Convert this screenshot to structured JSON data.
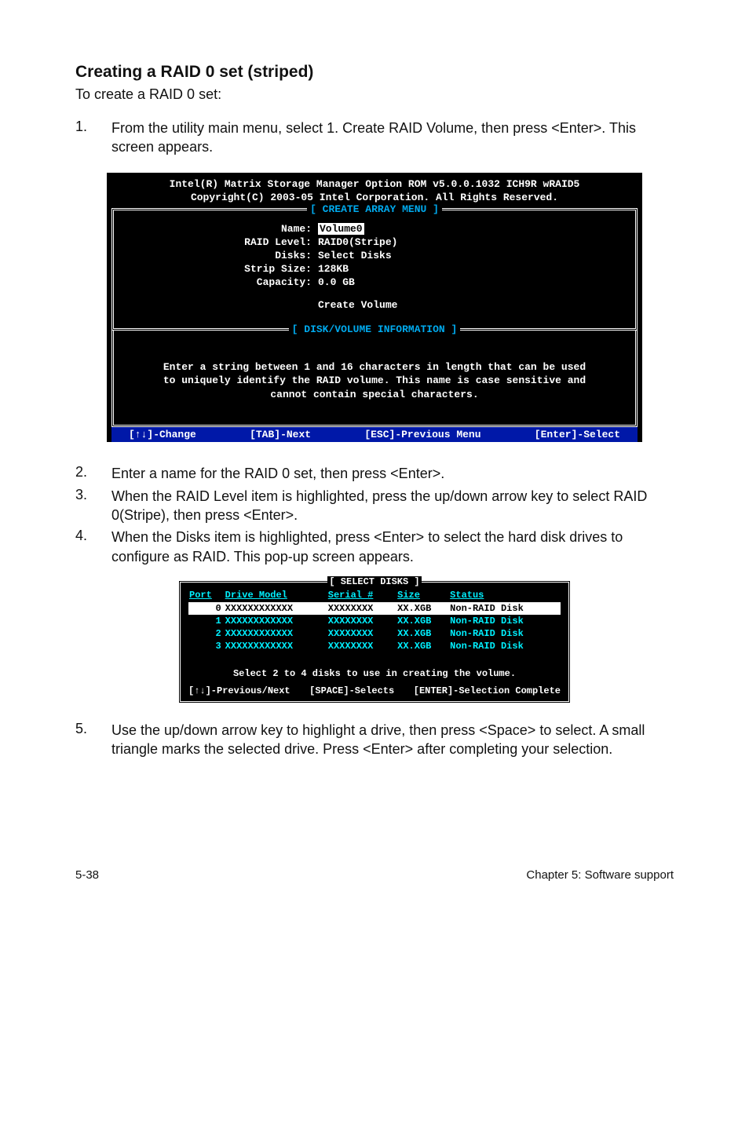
{
  "section": {
    "title": "Creating a RAID 0 set (striped)",
    "intro": "To create a RAID 0 set:"
  },
  "steps": {
    "s1": {
      "num": "1.",
      "text": "From the utility main menu, select 1. Create RAID Volume, then press <Enter>. This screen appears."
    },
    "s2": {
      "num": "2.",
      "text": "Enter a name for the RAID 0 set, then press <Enter>."
    },
    "s3": {
      "num": "3.",
      "text": "When the RAID Level item is highlighted, press the up/down arrow key to select RAID 0(Stripe), then press <Enter>."
    },
    "s4": {
      "num": "4.",
      "text": "When the Disks item is highlighted, press <Enter> to select the hard disk drives to configure as RAID. This pop-up screen appears."
    },
    "s5": {
      "num": "5.",
      "text": "Use the up/down arrow key to highlight a drive, then press <Space>  to select. A small triangle marks the selected drive. Press <Enter> after completing your selection."
    }
  },
  "bios": {
    "banner_l1": "Intel(R) Matrix Storage Manager Option ROM v5.0.0.1032 ICH9R wRAID5",
    "banner_l2": "Copyright(C) 2003-05 Intel Corporation. All Rights Reserved.",
    "create_menu": "[ CREATE ARRAY MENU ]",
    "labels": {
      "name": "Name:",
      "raid_level": "RAID Level:",
      "disks": "Disks:",
      "strip_size": "Strip Size:",
      "capacity": "Capacity:"
    },
    "values": {
      "name": "Volume0",
      "raid_level": "RAID0(Stripe)",
      "disks": "Select Disks",
      "strip_size": "128KB",
      "capacity": "0.0   GB"
    },
    "create_volume": "Create Volume",
    "disk_menu": "[ DISK/VOLUME INFORMATION ]",
    "info_l1": "Enter a string between 1 and 16 characters in length that can be used",
    "info_l2": "to uniquely identify the RAID volume. This name is case sensitive and",
    "info_l3": "cannot contain special characters.",
    "footer": {
      "change": "[↑↓]-Change",
      "tab": "[TAB]-Next",
      "esc": "[ESC]-Previous Menu",
      "enter": "[Enter]-Select"
    }
  },
  "disks_screen": {
    "title": "[ SELECT DISKS ]",
    "cols": {
      "port": "Port",
      "model": "Drive Model",
      "serial": "Serial #",
      "size": "Size",
      "status": "Status"
    },
    "rows": [
      {
        "port": "0",
        "model": "XXXXXXXXXXXX",
        "serial": "XXXXXXXX",
        "size": "XX.XGB",
        "status": "Non-RAID Disk"
      },
      {
        "port": "1",
        "model": "XXXXXXXXXXXX",
        "serial": "XXXXXXXX",
        "size": "XX.XGB",
        "status": "Non-RAID Disk"
      },
      {
        "port": "2",
        "model": "XXXXXXXXXXXX",
        "serial": "XXXXXXXX",
        "size": "XX.XGB",
        "status": "Non-RAID Disk"
      },
      {
        "port": "3",
        "model": "XXXXXXXXXXXX",
        "serial": "XXXXXXXX",
        "size": "XX.XGB",
        "status": "Non-RAID Disk"
      }
    ],
    "note": "Select 2 to 4 disks to use in creating the volume.",
    "footer": {
      "prev": "[↑↓]-Previous/Next",
      "space": "[SPACE]-Selects",
      "enter": "[ENTER]-Selection Complete"
    }
  },
  "page_footer": {
    "left": "5-38",
    "right": "Chapter 5: Software support"
  }
}
